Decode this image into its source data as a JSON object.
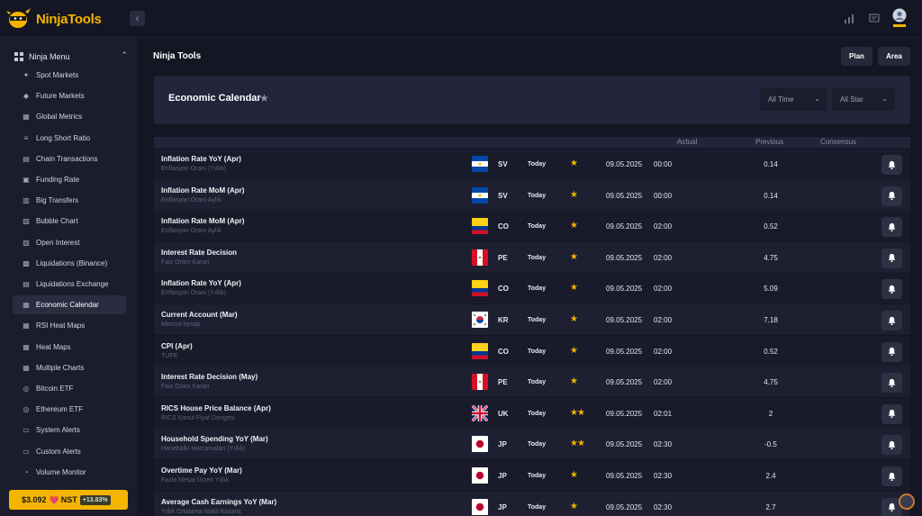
{
  "app": {
    "logo_text": "NinjaTools"
  },
  "sidebar": {
    "menu_title": "Ninja Menu",
    "items": [
      {
        "label": "Spot Markets",
        "icon": "spot-icon"
      },
      {
        "label": "Future Markets",
        "icon": "future-icon"
      },
      {
        "label": "Global Metrics",
        "icon": "globe-icon"
      },
      {
        "label": "Long Short Ratio",
        "icon": "ratio-icon"
      },
      {
        "label": "Chain Transactions",
        "icon": "chain-icon"
      },
      {
        "label": "Funding Rate",
        "icon": "funding-icon"
      },
      {
        "label": "Big Transfers",
        "icon": "transfer-icon"
      },
      {
        "label": "Bubble Chart",
        "icon": "bubble-icon"
      },
      {
        "label": "Open Interest",
        "icon": "interest-icon"
      },
      {
        "label": "Liquidations (Binance)",
        "icon": "liquidation-icon"
      },
      {
        "label": "Liquidations Exchange",
        "icon": "exchange-icon"
      },
      {
        "label": "Economic Calendar",
        "icon": "calendar-icon",
        "active": true
      },
      {
        "label": "RSI Heat Maps",
        "icon": "rsi-icon"
      },
      {
        "label": "Heat Maps",
        "icon": "heatmap-icon"
      },
      {
        "label": "Multiple Charts",
        "icon": "charts-icon"
      },
      {
        "label": "Bitcoin ETF",
        "icon": "bitcoin-icon"
      },
      {
        "label": "Ethereum ETF",
        "icon": "ethereum-icon"
      },
      {
        "label": "System Alerts",
        "icon": "system-alert-icon"
      },
      {
        "label": "Custom Alerts",
        "icon": "custom-alert-icon"
      },
      {
        "label": "Volume Monitor",
        "icon": "volume-icon"
      }
    ],
    "price_widget": {
      "price": "$3.092",
      "ticker": "NST",
      "change": "+13.83%"
    }
  },
  "header": {
    "page_title": "Ninja Tools",
    "plan_label": "Plan",
    "area_label": "Area"
  },
  "calendar": {
    "title": "Economic Calendar",
    "filter_time": "All Time",
    "filter_star": "All Star",
    "columns": {
      "actual": "Actual",
      "previous": "Previous",
      "consensus": "Consensus"
    },
    "rows": [
      {
        "name": "Inflation Rate YoY (Apr)",
        "sub": "Enflasyon Oranı (Yıllık)",
        "flag": "SV",
        "country": "SV",
        "day": "Today",
        "stars": "★",
        "date": "09.05.2025",
        "time": "00:00",
        "previous": "0.14"
      },
      {
        "name": "Inflation Rate MoM (Apr)",
        "sub": "Enflasyon Oranı Aylık",
        "flag": "SV",
        "country": "SV",
        "day": "Today",
        "stars": "★",
        "date": "09.05.2025",
        "time": "00:00",
        "previous": "0.14"
      },
      {
        "name": "Inflation Rate MoM (Apr)",
        "sub": "Enflasyon Oranı Aylık",
        "flag": "CO",
        "country": "CO",
        "day": "Today",
        "stars": "★",
        "date": "09.05.2025",
        "time": "02:00",
        "previous": "0.52"
      },
      {
        "name": "Interest Rate Decision",
        "sub": "Faiz Oranı Kararı",
        "flag": "PE",
        "country": "PE",
        "day": "Today",
        "stars": "★",
        "date": "09.05.2025",
        "time": "02:00",
        "previous": "4.75"
      },
      {
        "name": "Inflation Rate YoY (Apr)",
        "sub": "Enflasyon Oranı (Yıllık)",
        "flag": "CO",
        "country": "CO",
        "day": "Today",
        "stars": "★",
        "date": "09.05.2025",
        "time": "02:00",
        "previous": "5.09"
      },
      {
        "name": "Current Account (Mar)",
        "sub": "Mevcut hesap",
        "flag": "KR",
        "country": "KR",
        "day": "Today",
        "stars": "★",
        "date": "09.05.2025",
        "time": "02:00",
        "previous": "7.18"
      },
      {
        "name": "CPI (Apr)",
        "sub": "TÜFE",
        "flag": "CO",
        "country": "CO",
        "day": "Today",
        "stars": "★",
        "date": "09.05.2025",
        "time": "02:00",
        "previous": "0.52"
      },
      {
        "name": "Interest Rate Decision (May)",
        "sub": "Faiz Oranı Kararı",
        "flag": "PE",
        "country": "PE",
        "day": "Today",
        "stars": "★",
        "date": "09.05.2025",
        "time": "02:00",
        "previous": "4.75"
      },
      {
        "name": "RICS House Price Balance (Apr)",
        "sub": "RICS Konut Fiyat Dengesi",
        "flag": "UK",
        "country": "UK",
        "day": "Today",
        "stars": "★★",
        "date": "09.05.2025",
        "time": "02:01",
        "previous": "2"
      },
      {
        "name": "Household Spending YoY (Mar)",
        "sub": "Hanehalkı Harcamaları (Yıllık)",
        "flag": "JP",
        "country": "JP",
        "day": "Today",
        "stars": "★★",
        "date": "09.05.2025",
        "time": "02:30",
        "previous": "-0.5"
      },
      {
        "name": "Overtime Pay YoY (Mar)",
        "sub": "Fazla Mesai Ücreti Yıllık",
        "flag": "JP",
        "country": "JP",
        "day": "Today",
        "stars": "★",
        "date": "09.05.2025",
        "time": "02:30",
        "previous": "2.4"
      },
      {
        "name": "Average Cash Earnings YoY (Mar)",
        "sub": "Yıllık Ortalama Nakit Kazanç",
        "flag": "JP",
        "country": "JP",
        "day": "Today",
        "stars": "★",
        "date": "09.05.2025",
        "time": "02:30",
        "previous": "2.7"
      }
    ]
  },
  "colors": {
    "accent": "#f4b400",
    "bg": "#141624",
    "sidebar": "#1b1d2c",
    "card": "#22253a"
  }
}
